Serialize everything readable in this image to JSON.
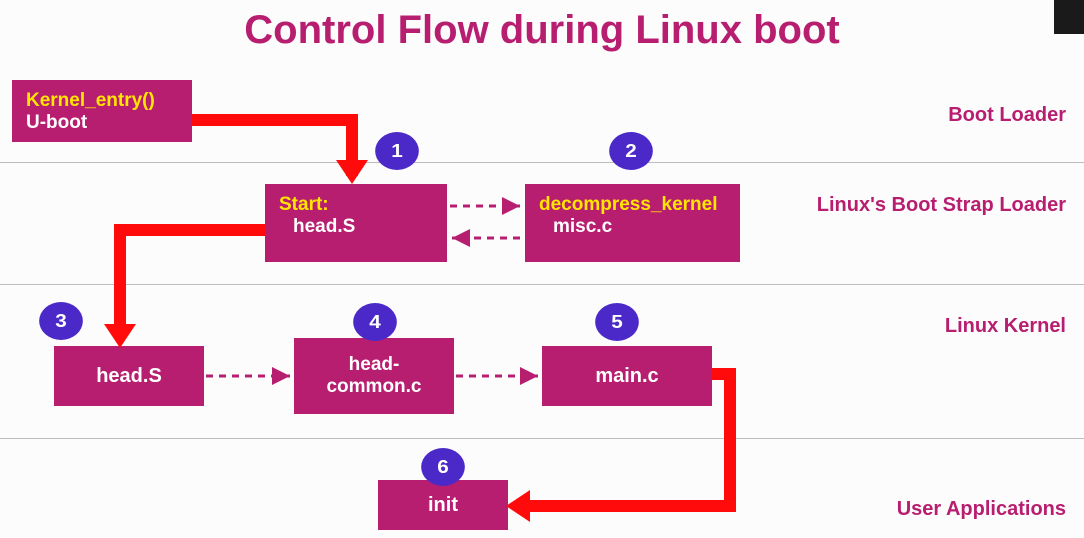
{
  "title": "Control Flow during Linux boot",
  "sections": {
    "bootloader": "Boot Loader",
    "bootstrap": "Linux's Boot Strap Loader",
    "kernel": "Linux Kernel",
    "userapps": "User Applications"
  },
  "nodes": {
    "uboot": {
      "top": "Kernel_entry()",
      "sub": "U-boot"
    },
    "headS": {
      "top": "Start:",
      "sub": "head.S"
    },
    "misc": {
      "top": "decompress_kernel",
      "sub": "misc.c"
    },
    "headS2": {
      "label": "head.S"
    },
    "common": {
      "label": "head-common.c"
    },
    "main": {
      "label": "main.c"
    },
    "init": {
      "label": "init"
    }
  },
  "badges": {
    "b1": "1",
    "b2": "2",
    "b3": "3",
    "b4": "4",
    "b5": "5",
    "b6": "6"
  }
}
